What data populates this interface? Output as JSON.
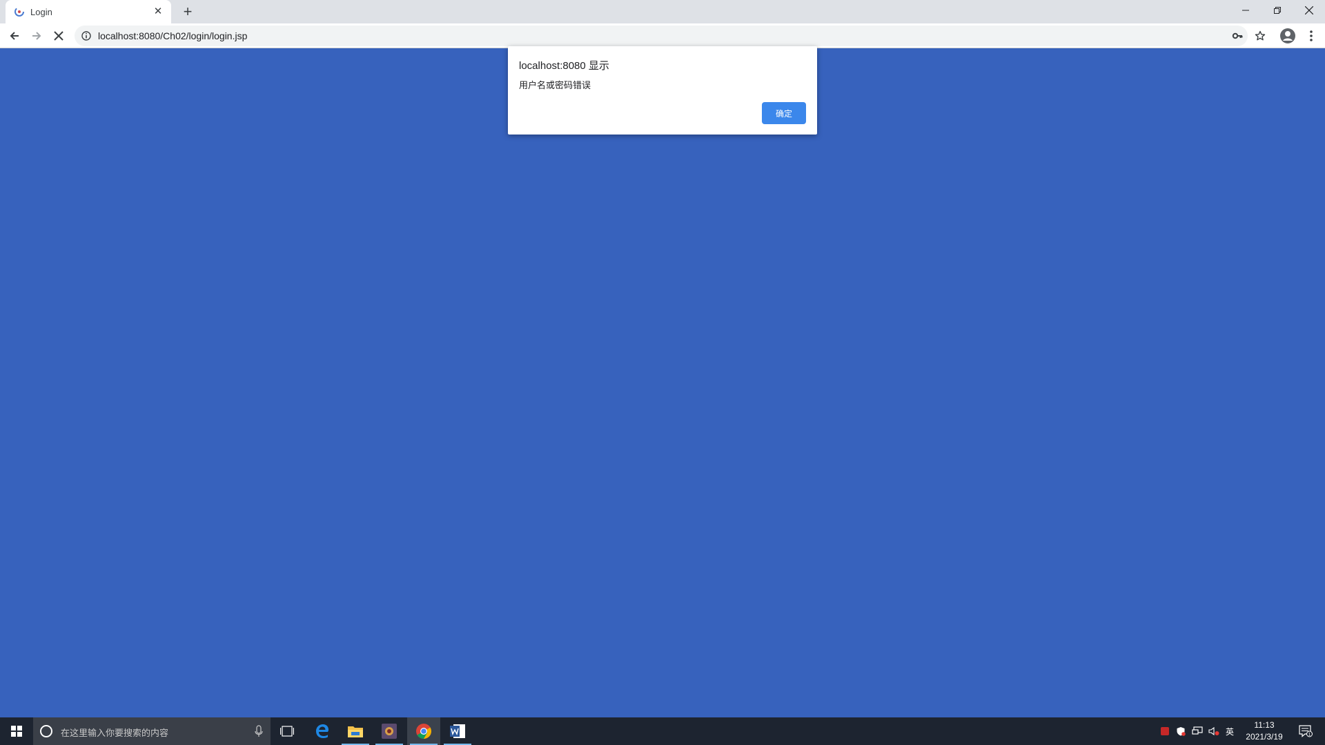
{
  "browser": {
    "tab": {
      "title": "Login",
      "close_glyph": "✕"
    },
    "new_tab_glyph": "+",
    "address_bar": {
      "url": "localhost:8080/Ch02/login/login.jsp"
    },
    "page_background": "#3762bd",
    "icons": [
      "back-icon",
      "forward-icon",
      "stop-loading-icon",
      "info-icon",
      "key-icon",
      "star-icon",
      "profile-icon",
      "menu-icon"
    ]
  },
  "dialog": {
    "title": "localhost:8080 显示",
    "message": "用户名或密码错误",
    "ok_label": "确定"
  },
  "taskbar": {
    "search_placeholder": "在这里输入你要搜索的内容",
    "apps": [
      "task-view-icon",
      "edge-icon",
      "file-explorer-icon",
      "app-icon",
      "chrome-icon",
      "word-icon"
    ],
    "tray": {
      "ime_label": "英"
    },
    "clock": {
      "time": "11:13",
      "date": "2021/3/19"
    },
    "notification_count": "1"
  }
}
